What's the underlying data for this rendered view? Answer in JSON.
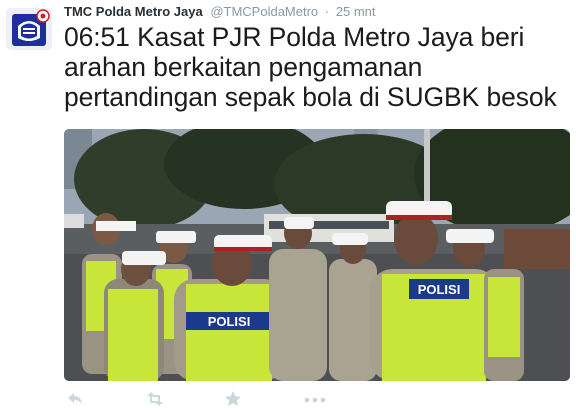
{
  "tweet": {
    "author_name": "TMC Polda Metro Jaya",
    "handle": "@TMCPoldaMetro",
    "separator": "·",
    "time_ago": "25 mnt",
    "text_lines": [
      "06:51 Kasat PJR Polda Metro Jaya beri",
      "arahan berkaitan pengamanan",
      "pertandingan sepak bola di SUGBK besok"
    ],
    "media": {
      "vest_text_left": "POLISI",
      "vest_text_right": "POLISI"
    },
    "actions": {
      "reply_icon": "reply-icon",
      "retweet_icon": "retweet-icon",
      "favorite_icon": "star-icon",
      "more_icon": "more-icon"
    }
  },
  "colors": {
    "name": "#292f33",
    "meta": "#8899a6",
    "action_icon": "#ccd6dd",
    "vest": "#c8e63a",
    "avatar_blue": "#2233aa"
  }
}
